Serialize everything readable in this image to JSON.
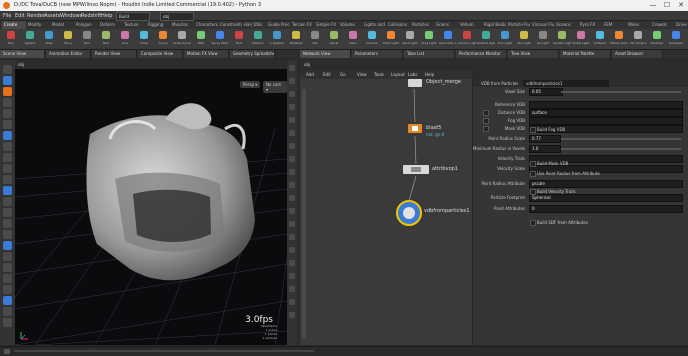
{
  "window": {
    "title": "D:/DC Tova/DuCB (now MPW/linso Nopm) - Houdini Indie Limited Commercial (19.0.402) - Python 3",
    "minimize": "—",
    "maximize": "☐",
    "close": "✕"
  },
  "menu": [
    "File",
    "Edit",
    "Render",
    "Assets",
    "Windows",
    "Redshift",
    "Help"
  ],
  "desktop": {
    "name": "Build",
    "context": "obj"
  },
  "shelf_tabs": [
    "Create",
    "Modify",
    "Model",
    "Polygon",
    "Deform",
    "Texture",
    "Rigging",
    "Muscles",
    "Characters",
    "Constraints",
    "Hair Utils",
    "Guide Process",
    "Terrain FX",
    "Simple FX",
    "Volume",
    "Lights and Cameras",
    "Collisions",
    "Particles",
    "Grains",
    "Vellum",
    "Rigid Bodies",
    "Particle Fluids",
    "Viscous Fluids",
    "Oceans",
    "Pyro FX",
    "FEM",
    "Wires",
    "Crowds",
    "Drive Simulation"
  ],
  "shelf_tools": [
    "Box",
    "Sphere",
    "Tube",
    "Torus",
    "Grid",
    "Null",
    "Line",
    "Circle",
    "Curve",
    "Draw Curve",
    "Path",
    "Spray Paint",
    "Font",
    "Platonic",
    "L-System",
    "Metaball",
    "File",
    "Spiral",
    "Helix",
    "Camera",
    "Point Light",
    "Spot Light",
    "Area Light",
    "Geometry Light",
    "Volume Light",
    "Distant Light",
    "Env Light",
    "Sky Light",
    "GI Light",
    "Caustic Light",
    "Portal Light",
    "Ambient",
    "Stereo Cam",
    "VR Camera",
    "Switcher",
    "Gamepad"
  ],
  "left_pane_tabs": [
    "Scene View",
    "Animation Editor",
    "Render View",
    "Composite View",
    "Motion FX View",
    "Geometry Spreadsheet"
  ],
  "right_pane_tabs": [
    "Network View",
    "Parameters",
    "Take List",
    "Performance Monitor",
    "Tree View",
    "Material Palette",
    "Asset Browser"
  ],
  "viewport": {
    "path": "obj",
    "title": "Persp",
    "camera_menu": "Persp ▾",
    "cam_label": "No cam ▾",
    "fps": "3.0fps",
    "stats": [
      "Wireframe",
      "1 prims",
      "1 points",
      "1 vertices"
    ]
  },
  "network": {
    "path": "obj",
    "menu": [
      "Add",
      "Edit",
      "Go",
      "View",
      "Tools",
      "Layout",
      "Labs",
      "Help"
    ],
    "nodes": [
      {
        "name": "Object_merge",
        "sub": ""
      },
      {
        "name": "blast5",
        "sub": "not: @i-0"
      },
      {
        "name": "attribvop1",
        "sub": ""
      },
      {
        "name": "vdbfromparticles1",
        "sub": ""
      }
    ]
  },
  "params": {
    "node_type": "VDB from Particles",
    "node_name": "vdbfromparticles1",
    "rows": [
      {
        "label": "Voxel Size",
        "value": "0.05"
      },
      {
        "label": "Reference VDB",
        "value": ""
      },
      {
        "label": "Distance VDB",
        "value": "surface"
      },
      {
        "label": "Fog VDB",
        "value": ""
      },
      {
        "label": "Mask VDB",
        "value": ""
      },
      {
        "label": "Point Radius Scale",
        "value": "0.77"
      },
      {
        "label": "Minimum Radius in Voxels",
        "value": "1.0"
      },
      {
        "label": "Velocity Trails",
        "value": ""
      },
      {
        "label": "Velocity Scale",
        "value": ""
      },
      {
        "label": "Point Radius Attribute",
        "value": "pscale"
      },
      {
        "label": "Particle Footprint",
        "value": "Spherical"
      },
      {
        "label": "Point Attributes",
        "value": "0"
      }
    ],
    "checkboxes": [
      "Build Fog VDB",
      "Build Mask VDB",
      "Use Point Radius from Attribute",
      "Build Velocity Trails",
      "Build SDF from Attributes"
    ]
  },
  "colors": {
    "accent_orange": "#e8711e",
    "node_selected": "#f2c400",
    "vdb_node": "#3a7bd5"
  }
}
